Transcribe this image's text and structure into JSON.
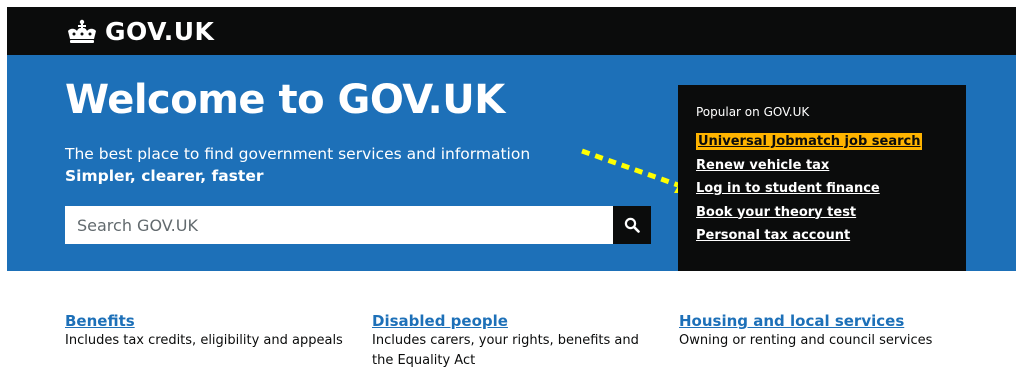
{
  "header": {
    "logo_text": "GOV.UK",
    "logo_icon": "crown-icon"
  },
  "hero": {
    "title": "Welcome to GOV.UK",
    "description": "The best place to find government services and information",
    "tagline": "Simpler, clearer, faster"
  },
  "search": {
    "placeholder": "Search GOV.UK",
    "value": "",
    "button_icon": "search-icon"
  },
  "popular": {
    "heading": "Popular on GOV.UK",
    "links": [
      {
        "label": "Universal Jobmatch job search",
        "highlighted": true
      },
      {
        "label": "Renew vehicle tax"
      },
      {
        "label": "Log in to student finance"
      },
      {
        "label": "Book your theory test"
      },
      {
        "label": "Personal tax account"
      }
    ]
  },
  "topics": [
    {
      "title": "Benefits",
      "description": "Includes tax credits, eligibility and appeals"
    },
    {
      "title": "Disabled people",
      "description": "Includes carers, your rights, benefits and the Equality Act"
    },
    {
      "title": "Housing and local services",
      "description": "Owning or renting and council services"
    }
  ],
  "colors": {
    "header_bg": "#0b0c0c",
    "hero_bg": "#1d70b8",
    "link": "#1d70b8",
    "highlight": "#ffb400",
    "annotation_arrow": "#ffff00"
  }
}
